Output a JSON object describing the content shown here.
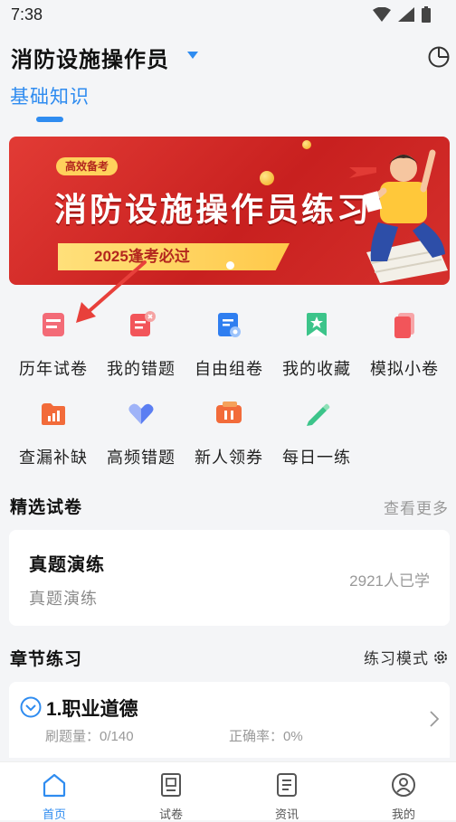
{
  "status_bar": {
    "time": "7:38"
  },
  "header": {
    "title": "消防设施操作员",
    "subtitle": "基础知识"
  },
  "banner": {
    "tag": "高效备考",
    "headline": "消防设施操作员练习",
    "pill": "2025逢考必过"
  },
  "grid": [
    {
      "label": "历年试卷",
      "icon": "exam-papers-icon"
    },
    {
      "label": "我的错题",
      "icon": "wrong-questions-icon"
    },
    {
      "label": "自由组卷",
      "icon": "custom-paper-icon"
    },
    {
      "label": "我的收藏",
      "icon": "favorites-icon"
    },
    {
      "label": "模拟小卷",
      "icon": "mock-exam-icon"
    },
    {
      "label": "查漏补缺",
      "icon": "gap-filling-icon"
    },
    {
      "label": "高频错题",
      "icon": "frequent-errors-icon"
    },
    {
      "label": "新人领券",
      "icon": "coupon-icon"
    },
    {
      "label": "每日一练",
      "icon": "daily-practice-icon"
    }
  ],
  "featured": {
    "title": "精选试卷",
    "more": "查看更多",
    "card": {
      "title": "真题演练",
      "subtitle": "真题演练",
      "learners": "2921人已学"
    }
  },
  "chapters": {
    "title": "章节练习",
    "mode": "练习模式",
    "item": {
      "name": "1.职业道德",
      "progress_label": "刷题量：",
      "progress_value": "0/140",
      "accuracy_label": "正确率：",
      "accuracy_value": "0%"
    }
  },
  "nav": [
    {
      "label": "首页",
      "icon": "home-icon"
    },
    {
      "label": "试卷",
      "icon": "papers-icon"
    },
    {
      "label": "资讯",
      "icon": "news-icon"
    },
    {
      "label": "我的",
      "icon": "profile-icon"
    }
  ],
  "colors": {
    "accent": "#2f8cf0",
    "banner": "#d42b27",
    "annotation_arrow": "#e8403b"
  }
}
